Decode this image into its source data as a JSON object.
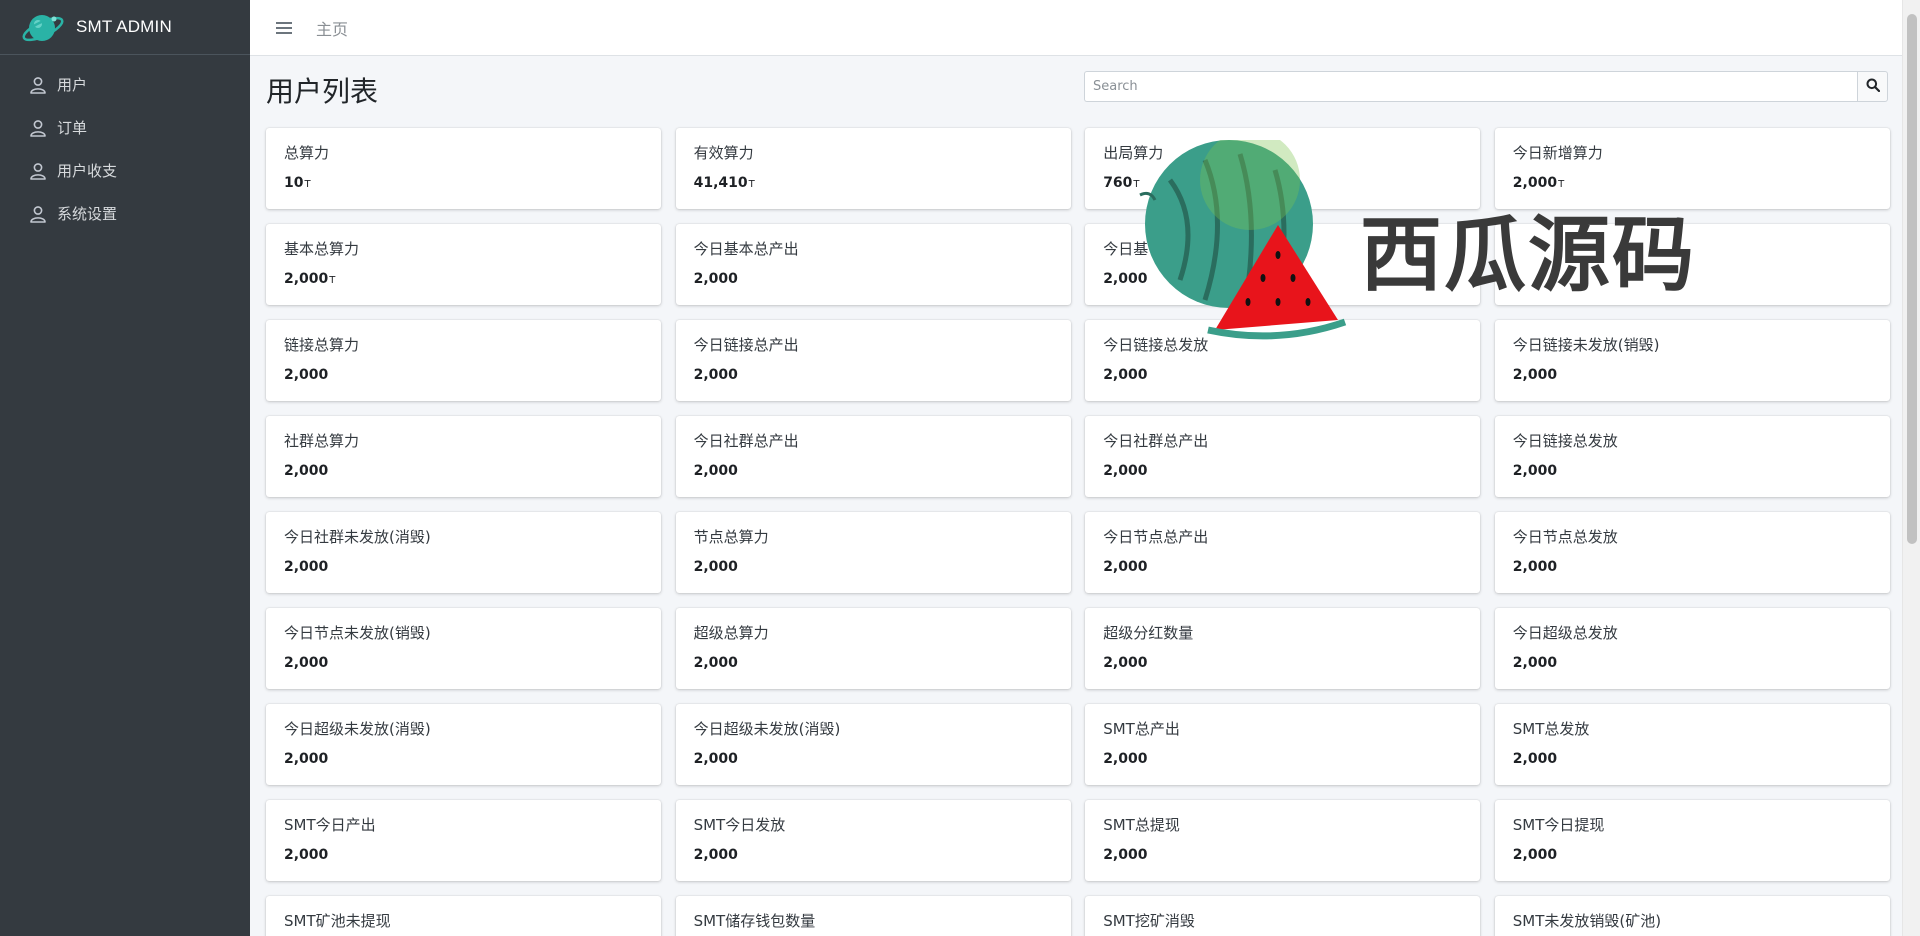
{
  "app": {
    "brand_name": "SMT ADMIN",
    "logo_icon": "planet-logo-icon"
  },
  "sidebar": {
    "items": [
      {
        "label": "用户",
        "icon": "user-icon"
      },
      {
        "label": "订单",
        "icon": "user-icon"
      },
      {
        "label": "用户收支",
        "icon": "user-icon"
      },
      {
        "label": "系统设置",
        "icon": "user-icon"
      }
    ]
  },
  "topbar": {
    "menu_icon": "hamburger-menu-icon",
    "home_label": "主页"
  },
  "page": {
    "title": "用户列表",
    "search_placeholder": "Search",
    "search_icon": "search-icon"
  },
  "cards": [
    {
      "label": "总算力",
      "value": "10",
      "unit": "T"
    },
    {
      "label": "有效算力",
      "value": "41,410",
      "unit": "T"
    },
    {
      "label": "出局算力",
      "value": "760",
      "unit": "T"
    },
    {
      "label": "今日新增算力",
      "value": "2,000",
      "unit": "T"
    },
    {
      "label": "基本总算力",
      "value": "2,000",
      "unit": "T"
    },
    {
      "label": "今日基本总产出",
      "value": "2,000",
      "unit": ""
    },
    {
      "label": "今日基",
      "value": "2,000",
      "unit": ""
    },
    {
      "label": "",
      "value": "",
      "unit": ""
    },
    {
      "label": "链接总算力",
      "value": "2,000",
      "unit": ""
    },
    {
      "label": "今日链接总产出",
      "value": "2,000",
      "unit": ""
    },
    {
      "label": "今日链接总发放",
      "value": "2,000",
      "unit": ""
    },
    {
      "label": "今日链接未发放(销毁)",
      "value": "2,000",
      "unit": ""
    },
    {
      "label": "社群总算力",
      "value": "2,000",
      "unit": ""
    },
    {
      "label": "今日社群总产出",
      "value": "2,000",
      "unit": ""
    },
    {
      "label": "今日社群总产出",
      "value": "2,000",
      "unit": ""
    },
    {
      "label": "今日链接总发放",
      "value": "2,000",
      "unit": ""
    },
    {
      "label": "今日社群未发放(消毁)",
      "value": "2,000",
      "unit": ""
    },
    {
      "label": "节点总算力",
      "value": "2,000",
      "unit": ""
    },
    {
      "label": "今日节点总产出",
      "value": "2,000",
      "unit": ""
    },
    {
      "label": "今日节点总发放",
      "value": "2,000",
      "unit": ""
    },
    {
      "label": "今日节点未发放(销毁)",
      "value": "2,000",
      "unit": ""
    },
    {
      "label": "超级总算力",
      "value": "2,000",
      "unit": ""
    },
    {
      "label": "超级分红数量",
      "value": "2,000",
      "unit": ""
    },
    {
      "label": "今日超级总发放",
      "value": "2,000",
      "unit": ""
    },
    {
      "label": "今日超级未发放(消毁)",
      "value": "2,000",
      "unit": ""
    },
    {
      "label": "今日超级未发放(消毁)",
      "value": "2,000",
      "unit": ""
    },
    {
      "label": "SMT总产出",
      "value": "2,000",
      "unit": ""
    },
    {
      "label": "SMT总发放",
      "value": "2,000",
      "unit": ""
    },
    {
      "label": "SMT今日产出",
      "value": "2,000",
      "unit": ""
    },
    {
      "label": "SMT今日发放",
      "value": "2,000",
      "unit": ""
    },
    {
      "label": "SMT总提现",
      "value": "2,000",
      "unit": ""
    },
    {
      "label": "SMT今日提现",
      "value": "2,000",
      "unit": ""
    },
    {
      "label": "SMT矿池未提现",
      "value": "",
      "unit": ""
    },
    {
      "label": "SMT储存钱包数量",
      "value": "",
      "unit": ""
    },
    {
      "label": "SMT挖矿消毁",
      "value": "",
      "unit": ""
    },
    {
      "label": "SMT未发放销毁(矿池)",
      "value": "",
      "unit": ""
    }
  ],
  "watermark": {
    "text": "西瓜源码",
    "icon": "watermelon-logo-icon"
  },
  "colors": {
    "sidebar_bg": "#343a40",
    "content_bg": "#f4f6f9",
    "card_bg": "#ffffff",
    "logo_teal": "#2ab3a6"
  }
}
